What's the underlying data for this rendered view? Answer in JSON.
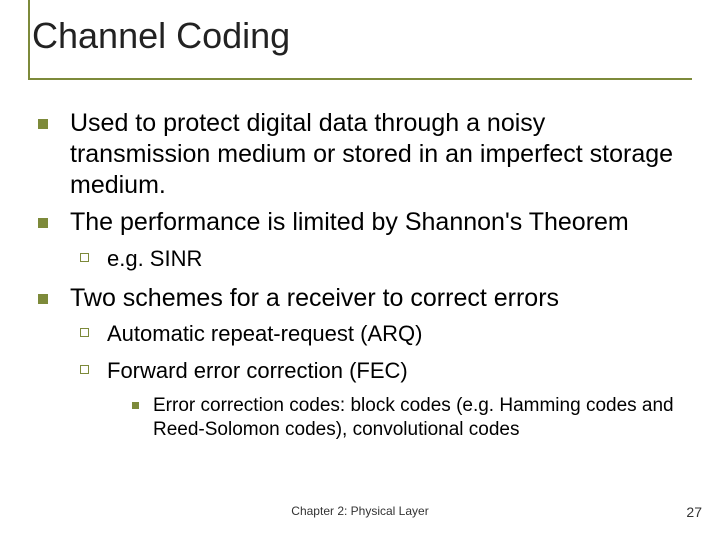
{
  "title": "Channel Coding",
  "bullets": [
    {
      "level": 1,
      "text": "Used to protect digital data through a noisy transmission medium or stored in an imperfect storage medium."
    },
    {
      "level": 1,
      "text": "The performance is limited by Shannon's Theorem"
    },
    {
      "level": 2,
      "text": "e.g. SINR"
    },
    {
      "level": 1,
      "text": "Two schemes for a receiver to correct errors"
    },
    {
      "level": 2,
      "text": "Automatic repeat-request (ARQ)"
    },
    {
      "level": 2,
      "text": "Forward error correction (FEC)"
    },
    {
      "level": 3,
      "text": "Error correction codes: block codes (e.g. Hamming codes and Reed-Solomon codes), convolutional codes"
    }
  ],
  "footer": "Chapter 2: Physical Layer",
  "page_number": "27",
  "colors": {
    "accent": "#7d8a3a"
  }
}
